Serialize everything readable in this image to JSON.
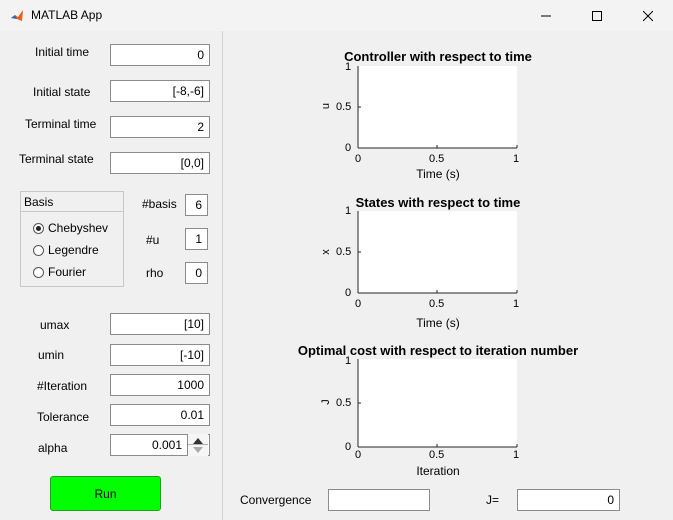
{
  "window": {
    "title": "MATLAB App",
    "icons": {
      "app": "matlab-icon",
      "minimize": "minimize-icon",
      "maximize": "maximize-icon",
      "close": "close-icon"
    }
  },
  "inputs": {
    "initial_time": {
      "label": "Initial time",
      "value": "0"
    },
    "initial_state": {
      "label": "Initial state",
      "value": "[-8,-6]"
    },
    "terminal_time": {
      "label": "Terminal time",
      "value": "2"
    },
    "terminal_state": {
      "label": "Terminal state",
      "value": "[0,0]"
    }
  },
  "basis": {
    "title": "Basis",
    "options": [
      "Chebyshev",
      "Legendre",
      "Fourier"
    ],
    "selected": "Chebyshev"
  },
  "params": {
    "nbasis": {
      "label": "#basis",
      "value": "6"
    },
    "nu": {
      "label": "#u",
      "value": "1"
    },
    "rho": {
      "label": "rho",
      "value": "0"
    }
  },
  "limits": {
    "umax": {
      "label": "umax",
      "value": "[10]"
    },
    "umin": {
      "label": "umin",
      "value": "[-10]"
    },
    "iteration": {
      "label": "#Iteration",
      "value": "1000"
    },
    "tolerance": {
      "label": "Tolerance",
      "value": "0.01"
    },
    "alpha": {
      "label": "alpha",
      "value": "0.001"
    }
  },
  "run_label": "Run",
  "plots": [
    {
      "title": "Controller with respect to time",
      "ylabel": "u",
      "xlabel": "Time (s)",
      "xticks": [
        "0",
        "0.5",
        "1"
      ],
      "yticks": [
        "0",
        "0.5",
        "1"
      ]
    },
    {
      "title": "States with respect to time",
      "ylabel": "x",
      "xlabel": "Time (s)",
      "xticks": [
        "0",
        "0.5",
        "1"
      ],
      "yticks": [
        "0",
        "0.5",
        "1"
      ]
    },
    {
      "title": "Optimal cost with respect to iteration number",
      "ylabel": "J",
      "xlabel": "Iteration",
      "xticks": [
        "0",
        "0.5",
        "1"
      ],
      "yticks": [
        "0",
        "0.5",
        "1"
      ]
    }
  ],
  "footer": {
    "convergence_label": "Convergence",
    "convergence_value": "",
    "j_label": "J=",
    "j_value": "0"
  }
}
